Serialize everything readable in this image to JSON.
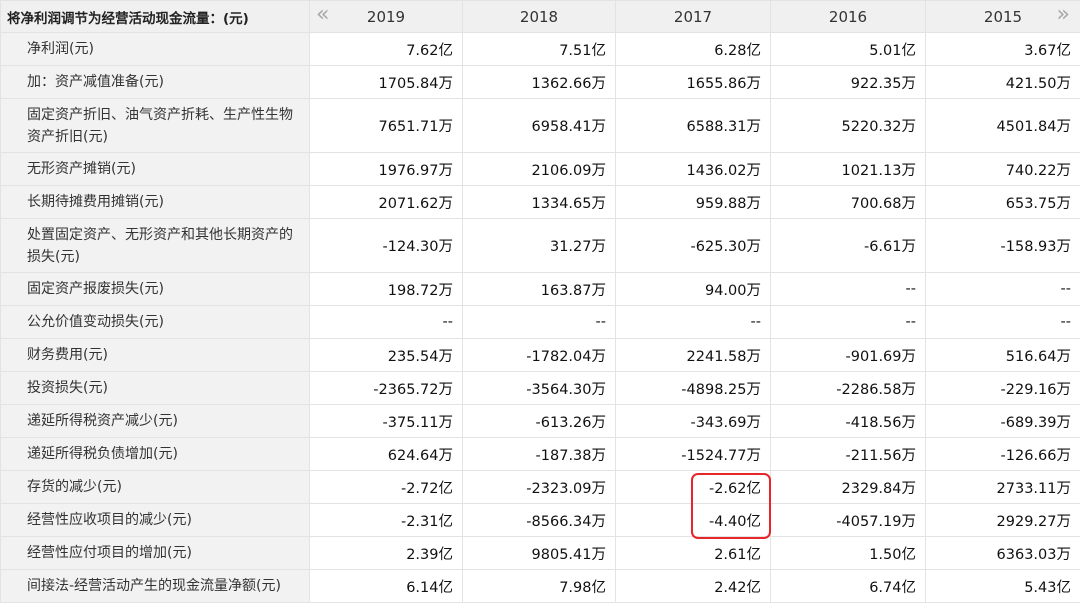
{
  "header": {
    "title": "将净利润调节为经营活动现金流量：(元)",
    "prev_icon": "«",
    "next_icon": "»",
    "years": [
      "2019",
      "2018",
      "2017",
      "2016",
      "2015"
    ]
  },
  "rows": [
    {
      "label": "净利润(元)",
      "values": [
        "7.62亿",
        "7.51亿",
        "6.28亿",
        "5.01亿",
        "3.67亿"
      ]
    },
    {
      "label": "加：资产减值准备(元)",
      "values": [
        "1705.84万",
        "1362.66万",
        "1655.86万",
        "922.35万",
        "421.50万"
      ]
    },
    {
      "label": "固定资产折旧、油气资产折耗、生产性生物资产折旧(元)",
      "values": [
        "7651.71万",
        "6958.41万",
        "6588.31万",
        "5220.32万",
        "4501.84万"
      ]
    },
    {
      "label": "无形资产摊销(元)",
      "values": [
        "1976.97万",
        "2106.09万",
        "1436.02万",
        "1021.13万",
        "740.22万"
      ]
    },
    {
      "label": "长期待摊费用摊销(元)",
      "values": [
        "2071.62万",
        "1334.65万",
        "959.88万",
        "700.68万",
        "653.75万"
      ]
    },
    {
      "label": "处置固定资产、无形资产和其他长期资产的损失(元)",
      "values": [
        "-124.30万",
        "31.27万",
        "-625.30万",
        "-6.61万",
        "-158.93万"
      ]
    },
    {
      "label": "固定资产报废损失(元)",
      "values": [
        "198.72万",
        "163.87万",
        "94.00万",
        "--",
        "--"
      ]
    },
    {
      "label": "公允价值变动损失(元)",
      "values": [
        "--",
        "--",
        "--",
        "--",
        "--"
      ]
    },
    {
      "label": "财务费用(元)",
      "values": [
        "235.54万",
        "-1782.04万",
        "2241.58万",
        "-901.69万",
        "516.64万"
      ]
    },
    {
      "label": "投资损失(元)",
      "values": [
        "-2365.72万",
        "-3564.30万",
        "-4898.25万",
        "-2286.58万",
        "-229.16万"
      ]
    },
    {
      "label": "递延所得税资产减少(元)",
      "values": [
        "-375.11万",
        "-613.26万",
        "-343.69万",
        "-418.56万",
        "-689.39万"
      ]
    },
    {
      "label": "递延所得税负债增加(元)",
      "values": [
        "624.64万",
        "-187.38万",
        "-1524.77万",
        "-211.56万",
        "-126.66万"
      ]
    },
    {
      "label": "存货的减少(元)",
      "values": [
        "-2.72亿",
        "-2323.09万",
        "-2.62亿",
        "2329.84万",
        "2733.11万"
      ]
    },
    {
      "label": "经营性应收项目的减少(元)",
      "values": [
        "-2.31亿",
        "-8566.34万",
        "-4.40亿",
        "-4057.19万",
        "2929.27万"
      ]
    },
    {
      "label": "经营性应付项目的增加(元)",
      "values": [
        "2.39亿",
        "9805.41万",
        "2.61亿",
        "1.50亿",
        "6363.03万"
      ]
    },
    {
      "label": "间接法-经营活动产生的现金流量净额(元)",
      "values": [
        "6.14亿",
        "7.98亿",
        "2.42亿",
        "6.74亿",
        "5.43亿"
      ]
    }
  ],
  "highlight_color": "#e8262a"
}
